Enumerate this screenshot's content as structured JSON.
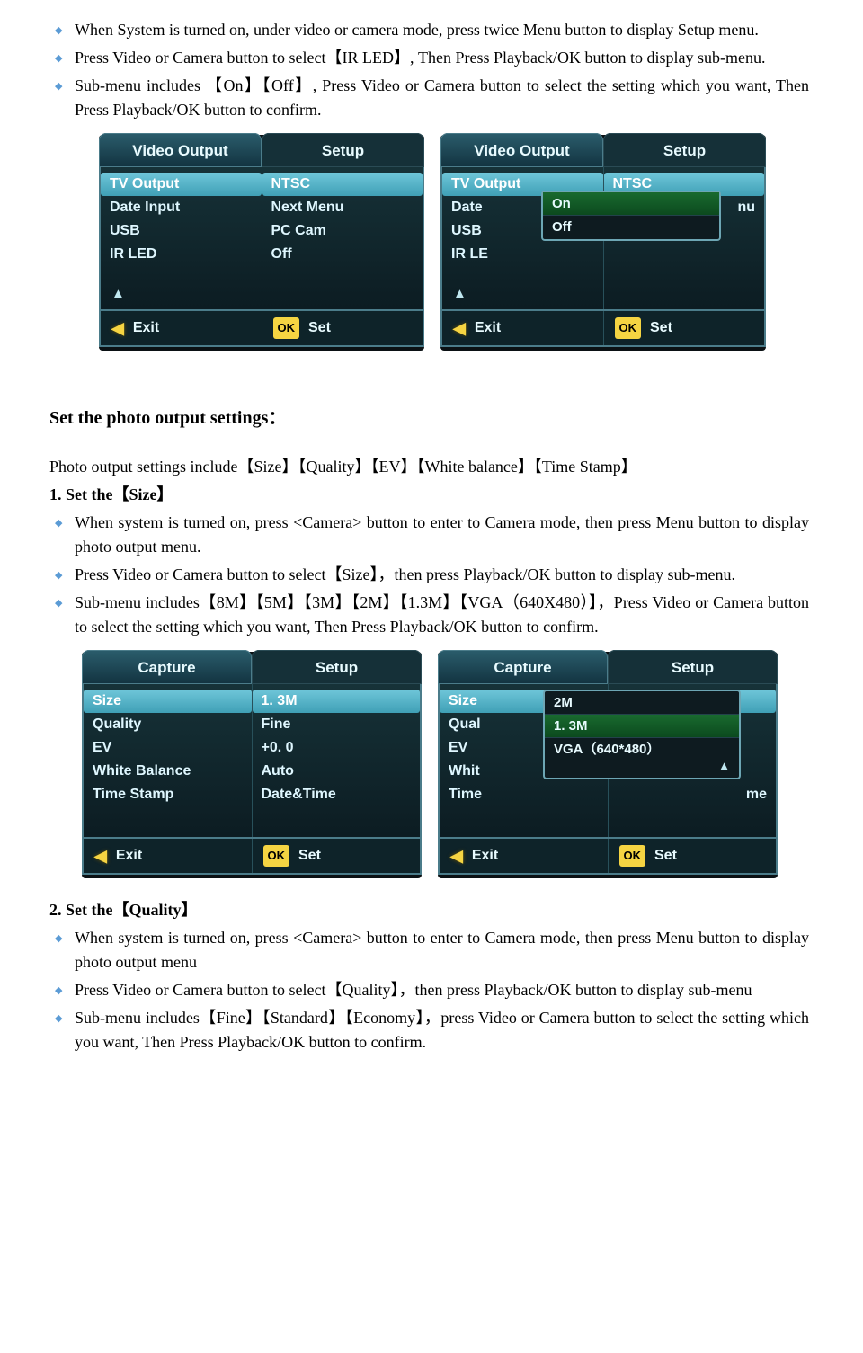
{
  "intro_bullets": [
    "When System is turned on, under video or camera mode, press twice Menu button to display Setup menu.",
    "Press Video or Camera button to select【IR LED】, Then Press Playback/OK button to display sub-menu.",
    "Sub-menu includes 【On】【Off】, Press Video or Camera button to select the setting which you want, Then Press Playback/OK button to confirm."
  ],
  "menu_a": {
    "tab_left": "Video Output",
    "tab_right": "Setup",
    "left_rows": [
      "TV Output",
      "Date Input",
      "USB",
      "IR LED"
    ],
    "right_rows": [
      "NTSC",
      "Next Menu",
      "PC Cam",
      "Off"
    ],
    "exit": "Exit",
    "ok": "OK",
    "set": "Set"
  },
  "menu_b": {
    "tab_left": "Video Output",
    "tab_right": "Setup",
    "left_rows": [
      "TV Output",
      "Date",
      "USB",
      "IR LE"
    ],
    "right_rows_visible": [
      "NTSC",
      "",
      "",
      ""
    ],
    "r_suffix": "nu",
    "popup": [
      "On",
      "Off"
    ],
    "exit": "Exit",
    "ok": "OK",
    "set": "Set"
  },
  "section_head": "Set the photo output settings：",
  "sub_intro": "Photo output settings include【Size】【Quality】【EV】【White balance】【Time Stamp】",
  "step1_head": "1.  Set the【Size】",
  "step1_bullets": [
    "When system is turned on, press <Camera> button to enter to Camera mode, then press Menu button to display photo output menu.",
    "Press Video or Camera button to select【Size】，then press Playback/OK button to display sub-menu.",
    "Sub-menu includes【8M】【5M】【3M】【2M】【1.3M】【VGA（640X480）】，Press Video or Camera button to select the setting which you want, Then Press Playback/OK button to confirm."
  ],
  "menu_c": {
    "tab_left": "Capture",
    "tab_right": "Setup",
    "left_rows": [
      "Size",
      "Quality",
      "EV",
      "White Balance",
      "Time Stamp"
    ],
    "right_rows": [
      "1. 3M",
      "Fine",
      "+0. 0",
      "Auto",
      "Date&Time"
    ],
    "exit": "Exit",
    "ok": "OK",
    "set": "Set"
  },
  "menu_d": {
    "tab_left": "Capture",
    "tab_right": "Setup",
    "left_rows": [
      "Size",
      "Qual",
      "EV",
      "Whit",
      "Time"
    ],
    "right_rows_visible": [
      "",
      "",
      "",
      "",
      "me"
    ],
    "popup": [
      "2M",
      "1. 3M",
      "VGA（640*480）"
    ],
    "exit": "Exit",
    "ok": "OK",
    "set": "Set"
  },
  "step2_head": "2.  Set the【Quality】",
  "step2_bullets": [
    "When system is turned on, press <Camera> button to enter to Camera mode, then press Menu button to display photo output menu",
    "Press Video or Camera button to select【Quality】，then press Playback/OK button to display sub-menu",
    "Sub-menu includes【Fine】【Standard】【Economy】，press Video or Camera button to select the setting which you want, Then Press Playback/OK button to confirm."
  ]
}
